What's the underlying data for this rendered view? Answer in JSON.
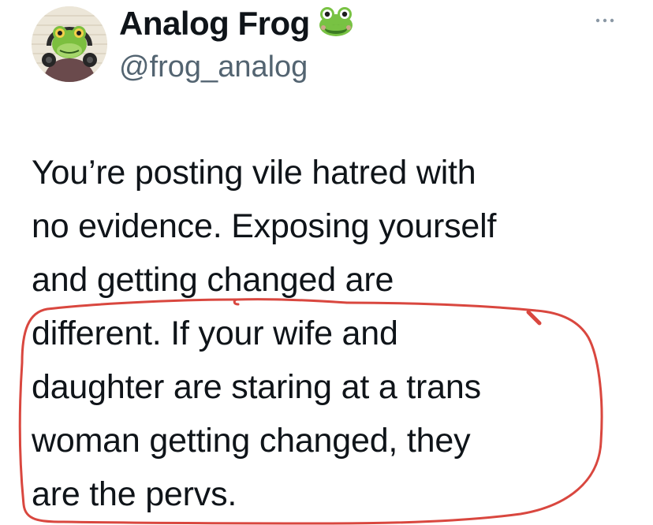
{
  "profile": {
    "display_name": "Analog Frog",
    "handle": "@frog_analog",
    "avatar_icon": "frog-with-headphones-avatar",
    "name_emoji_icon": "frog-face-emoji",
    "more_icon": "more-options-icon"
  },
  "tweet": {
    "lines": [
      "You’re posting vile hatred with",
      "no evidence. Exposing yourself",
      "and getting changed are",
      "different. If your wife and",
      "daughter are staring at a trans",
      "woman getting changed, they",
      "are the pervs."
    ]
  },
  "annotation": {
    "shape": "hand-drawn-circle",
    "color": "#d9473f"
  },
  "colors": {
    "text": "#0f1419",
    "secondary": "#536471",
    "frog_green": "#7cc242"
  }
}
